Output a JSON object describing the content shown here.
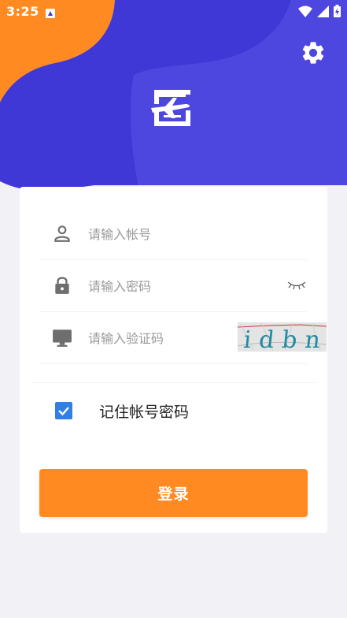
{
  "status_bar": {
    "time": "3:25"
  },
  "icons": {
    "settings": "gear-icon",
    "logo": "airplane-document-logo",
    "account": "person-icon",
    "password": "lock-icon",
    "visibility": "eye-closed-icon",
    "captcha_field": "monitor-icon"
  },
  "form": {
    "account_placeholder": "请输入帐号",
    "password_placeholder": "请输入密码",
    "captcha_placeholder": "请输入验证码",
    "captcha_text": "idbn",
    "remember_label": "记住帐号密码",
    "remember_checked": true,
    "login_label": "登录"
  },
  "colors": {
    "primary": "#3f37d6",
    "accent": "#ff8a22",
    "checkbox": "#2f7fe6",
    "background": "#f2f1f6"
  }
}
